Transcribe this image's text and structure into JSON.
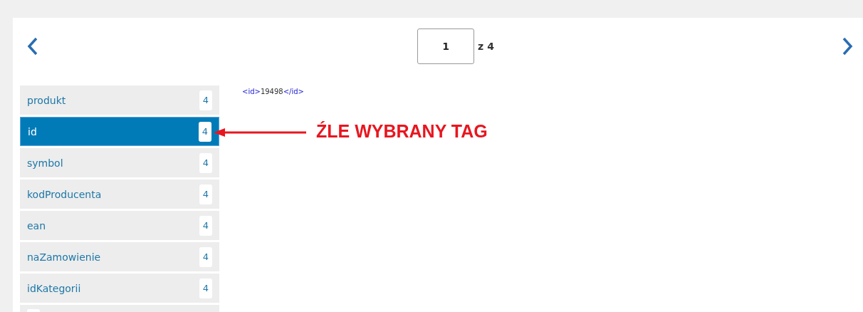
{
  "pager": {
    "page": "1",
    "total": "z 4"
  },
  "tags": [
    {
      "name": "produkt",
      "count": "4",
      "selected": false
    },
    {
      "name": "id",
      "count": "4",
      "selected": true
    },
    {
      "name": "symbol",
      "count": "4",
      "selected": false
    },
    {
      "name": "kodProducenta",
      "count": "4",
      "selected": false
    },
    {
      "name": "ean",
      "count": "4",
      "selected": false
    },
    {
      "name": "naZamowienie",
      "count": "4",
      "selected": false
    },
    {
      "name": "idKategorii",
      "count": "4",
      "selected": false
    }
  ],
  "preview": {
    "open_tag": "<id>",
    "value": "19498",
    "close_tag": "</id>"
  },
  "annotation": {
    "text": "ŹLE WYBRANY TAG"
  }
}
